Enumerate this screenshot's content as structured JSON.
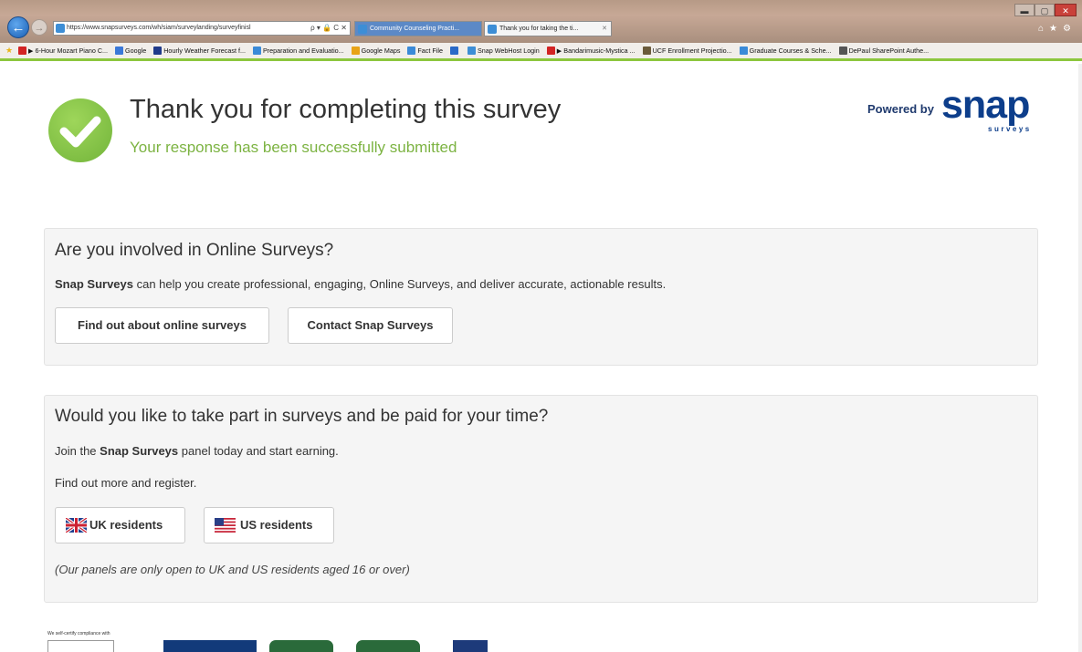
{
  "browser": {
    "url": "https://www.snapsurveys.com/wh/siam/surveylanding/surveyfinisl",
    "address_controls": "ρ ▾ 🔒 C ✕",
    "tabs": [
      {
        "label": "Community Counseling Practi..."
      },
      {
        "label": "Thank you for taking the ti...",
        "close": "✕"
      }
    ],
    "window_controls": {
      "min": "▬",
      "max": "▢",
      "close": "✕"
    },
    "toolbar_icons": "⌂★⚙",
    "favorites": [
      {
        "label": "▶ 6-Hour Mozart Piano C...",
        "color": "#d22323"
      },
      {
        "label": "Google",
        "color": "#3a78d8"
      },
      {
        "label": "Hourly Weather Forecast f...",
        "color": "#1f3a8a"
      },
      {
        "label": "Preparation and Evaluatio...",
        "color": "#3a8ad8"
      },
      {
        "label": "Google Maps",
        "color": "#e8a317"
      },
      {
        "label": "Fact File",
        "color": "#3a8ad8"
      },
      {
        "label": "",
        "color": "#2a6ac8"
      },
      {
        "label": "Snap WebHost Login",
        "color": "#3d8ed6"
      },
      {
        "label": "▶ Bandarimusic-Mystica ...",
        "color": "#d22323"
      },
      {
        "label": "UCF Enrollment Projectio...",
        "color": "#6a5a3a"
      },
      {
        "label": "Graduate Courses & Sche...",
        "color": "#3a8ad8"
      },
      {
        "label": "DePaul SharePoint Authe...",
        "color": "#555555"
      }
    ]
  },
  "header": {
    "title": "Thank you for completing this survey",
    "subtitle": "Your response has been successfully submitted",
    "powered_by": "Powered by",
    "brand": "snap",
    "brand_sub": "surveys"
  },
  "panel_online": {
    "heading": "Are you involved in Online Surveys?",
    "text_bold": "Snap Surveys",
    "text_rest": " can help you create professional, engaging, Online Surveys, and deliver accurate, actionable results.",
    "buttons": [
      {
        "label": "Find out about online surveys"
      },
      {
        "label": "Contact Snap Surveys"
      }
    ]
  },
  "panel_paid": {
    "heading": "Would you like to take part in surveys and be paid for your time?",
    "join_prefix": "Join the ",
    "join_bold": "Snap Surveys",
    "join_suffix": " panel today and start earning.",
    "find_more": "Find out more and register.",
    "buttons": [
      {
        "label": "UK residents"
      },
      {
        "label": "US residents"
      }
    ],
    "note": "(Our panels are only open to UK and US residents aged 16 or over)"
  },
  "footer": {
    "compliance": "We self-certify compliance with"
  },
  "colors": {
    "accent_green": "#7cb342",
    "brand_blue": "#0d3e8b",
    "panel_bg": "#f5f5f5"
  }
}
